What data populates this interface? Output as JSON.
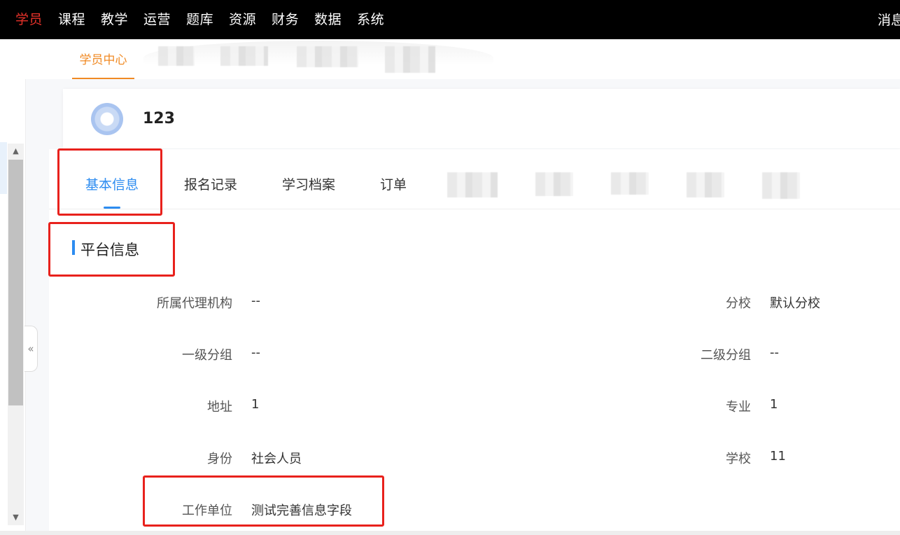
{
  "topnav": {
    "items": [
      "学员",
      "课程",
      "教学",
      "运营",
      "题库",
      "资源",
      "财务",
      "数据",
      "系统"
    ],
    "active_index": 0,
    "right_label": "消息"
  },
  "subnav": {
    "active_tab": "学员中心"
  },
  "profile": {
    "username": "123"
  },
  "tabs": {
    "items": [
      "基本信息",
      "报名记录",
      "学习档案",
      "订单"
    ],
    "active_index": 0
  },
  "section": {
    "title": "平台信息"
  },
  "fields": {
    "left": [
      {
        "label": "所属代理机构",
        "value": "--"
      },
      {
        "label": "一级分组",
        "value": "--"
      },
      {
        "label": "地址",
        "value": "1"
      },
      {
        "label": "身份",
        "value": "社会人员"
      },
      {
        "label": "工作单位",
        "value": "测试完善信息字段"
      }
    ],
    "right": [
      {
        "label": "分校",
        "value": "默认分校"
      },
      {
        "label": "二级分组",
        "value": "--"
      },
      {
        "label": "专业",
        "value": "1"
      },
      {
        "label": "学校",
        "value": "11"
      }
    ]
  },
  "colors": {
    "active_top": "#e8322a",
    "sub_accent": "#f08a24",
    "tab_accent": "#2d8cf0",
    "highlight_box": "#e8211c"
  }
}
